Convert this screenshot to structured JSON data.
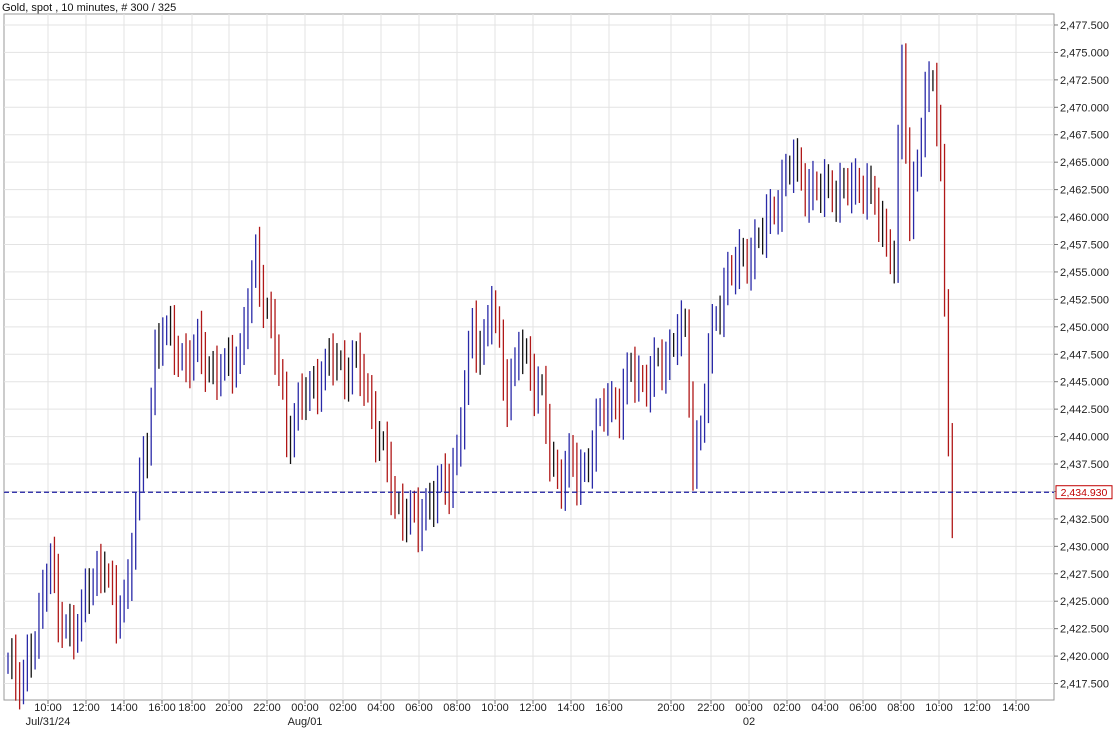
{
  "header": {
    "title": "Gold, spot , 10 minutes, # 300 / 325"
  },
  "colors": {
    "up_bar": "#2a2aa8",
    "down_bar": "#b01818",
    "neutral_bar": "#111111",
    "grid": "#e3e3e3",
    "ref_line": "#1c1ca0",
    "price_box_border": "#c00000",
    "price_box_text": "#c00000",
    "axis_text": "#222222"
  },
  "chart_data": {
    "type": "ohlc",
    "instrument": "Gold, spot",
    "interval": "10 minutes",
    "ylim": [
      2416,
      2478.5
    ],
    "y_ticks": [
      2417.5,
      2420,
      2422.5,
      2425,
      2427.5,
      2430,
      2432.5,
      2435,
      2437.5,
      2440,
      2442.5,
      2445,
      2447.5,
      2450,
      2452.5,
      2455,
      2457.5,
      2460,
      2462.5,
      2465,
      2467.5,
      2470,
      2472.5,
      2475,
      2477.5
    ],
    "y_tick_labels": [
      "2,417.500",
      "2,420.000",
      "2,422.500",
      "2,425.000",
      "2,427.500",
      "2,430.000",
      "2,432.500",
      "2,435.000",
      "2,437.500",
      "2,440.000",
      "2,442.500",
      "2,445.000",
      "2,447.500",
      "2,450.000",
      "2,452.500",
      "2,455.000",
      "2,457.500",
      "2,460.000",
      "2,462.500",
      "2,465.000",
      "2,467.500",
      "2,470.000",
      "2,472.500",
      "2,475.000",
      "2,477.500"
    ],
    "x_time_ticks": [
      "10:00",
      "12:00",
      "14:00",
      "16:00",
      "18:00",
      "20:00",
      "22:00",
      "00:00",
      "02:00",
      "04:00",
      "06:00",
      "08:00",
      "10:00",
      "12:00",
      "14:00",
      "16:00",
      "20:00",
      "22:00",
      "00:00",
      "02:00",
      "04:00",
      "06:00",
      "08:00",
      "10:00",
      "12:00",
      "14:00"
    ],
    "x_date_labels": [
      "Jul/31/24",
      "Aug/01",
      "02"
    ],
    "reference_line": {
      "value": 2434.93,
      "label": "2,434.930"
    },
    "grid": true,
    "keypoints": [
      [
        0,
        2419
      ],
      [
        3,
        2418
      ],
      [
        7,
        2421
      ],
      [
        10,
        2428
      ],
      [
        11,
        2430
      ],
      [
        13,
        2423
      ],
      [
        16,
        2422
      ],
      [
        21,
        2426
      ],
      [
        25,
        2429
      ],
      [
        28,
        2423
      ],
      [
        31,
        2427
      ],
      [
        33,
        2434
      ],
      [
        36,
        2439
      ],
      [
        38,
        2448
      ],
      [
        40,
        2450
      ],
      [
        43,
        2448
      ],
      [
        46,
        2447
      ],
      [
        49,
        2448
      ],
      [
        53,
        2446
      ],
      [
        56,
        2446
      ],
      [
        60,
        2448
      ],
      [
        62,
        2452
      ],
      [
        64,
        2456
      ],
      [
        66,
        2453
      ],
      [
        68,
        2450
      ],
      [
        70,
        2446
      ],
      [
        72,
        2440
      ],
      [
        75,
        2443
      ],
      [
        78,
        2444
      ],
      [
        81,
        2446
      ],
      [
        84,
        2447
      ],
      [
        87,
        2446
      ],
      [
        89,
        2447
      ],
      [
        92,
        2445
      ],
      [
        95,
        2441
      ],
      [
        98,
        2437
      ],
      [
        100,
        2434
      ],
      [
        103,
        2433
      ],
      [
        106,
        2432
      ],
      [
        108,
        2434
      ],
      [
        111,
        2435
      ],
      [
        114,
        2436
      ],
      [
        116,
        2439
      ],
      [
        118,
        2444
      ],
      [
        120,
        2450
      ],
      [
        122,
        2448
      ],
      [
        125,
        2452
      ],
      [
        127,
        2448
      ],
      [
        129,
        2444
      ],
      [
        132,
        2448
      ],
      [
        135,
        2446
      ],
      [
        138,
        2444
      ],
      [
        140,
        2438
      ],
      [
        142,
        2436
      ],
      [
        145,
        2438
      ],
      [
        147,
        2436
      ],
      [
        149,
        2437
      ],
      [
        152,
        2441
      ],
      [
        155,
        2443
      ],
      [
        158,
        2443
      ],
      [
        161,
        2446
      ],
      [
        164,
        2445
      ],
      [
        167,
        2446
      ],
      [
        170,
        2447
      ],
      [
        173,
        2450
      ],
      [
        175,
        2449
      ],
      [
        177,
        2438
      ],
      [
        179,
        2441
      ],
      [
        181,
        2447
      ],
      [
        183,
        2451
      ],
      [
        186,
        2455
      ],
      [
        190,
        2456
      ],
      [
        194,
        2458
      ],
      [
        197,
        2460
      ],
      [
        200,
        2463
      ],
      [
        203,
        2465
      ],
      [
        206,
        2463
      ],
      [
        209,
        2462
      ],
      [
        212,
        2463
      ],
      [
        215,
        2462
      ],
      [
        218,
        2463
      ],
      [
        221,
        2463
      ],
      [
        224,
        2461
      ],
      [
        227,
        2458
      ],
      [
        229,
        2456
      ],
      [
        231,
        2474
      ],
      [
        233,
        2460
      ],
      [
        235,
        2466
      ],
      [
        237,
        2470
      ],
      [
        239,
        2473
      ],
      [
        241,
        2465
      ],
      [
        243,
        2440
      ],
      [
        244,
        2432
      ]
    ]
  },
  "price_box": {
    "label": "2,434.930"
  }
}
